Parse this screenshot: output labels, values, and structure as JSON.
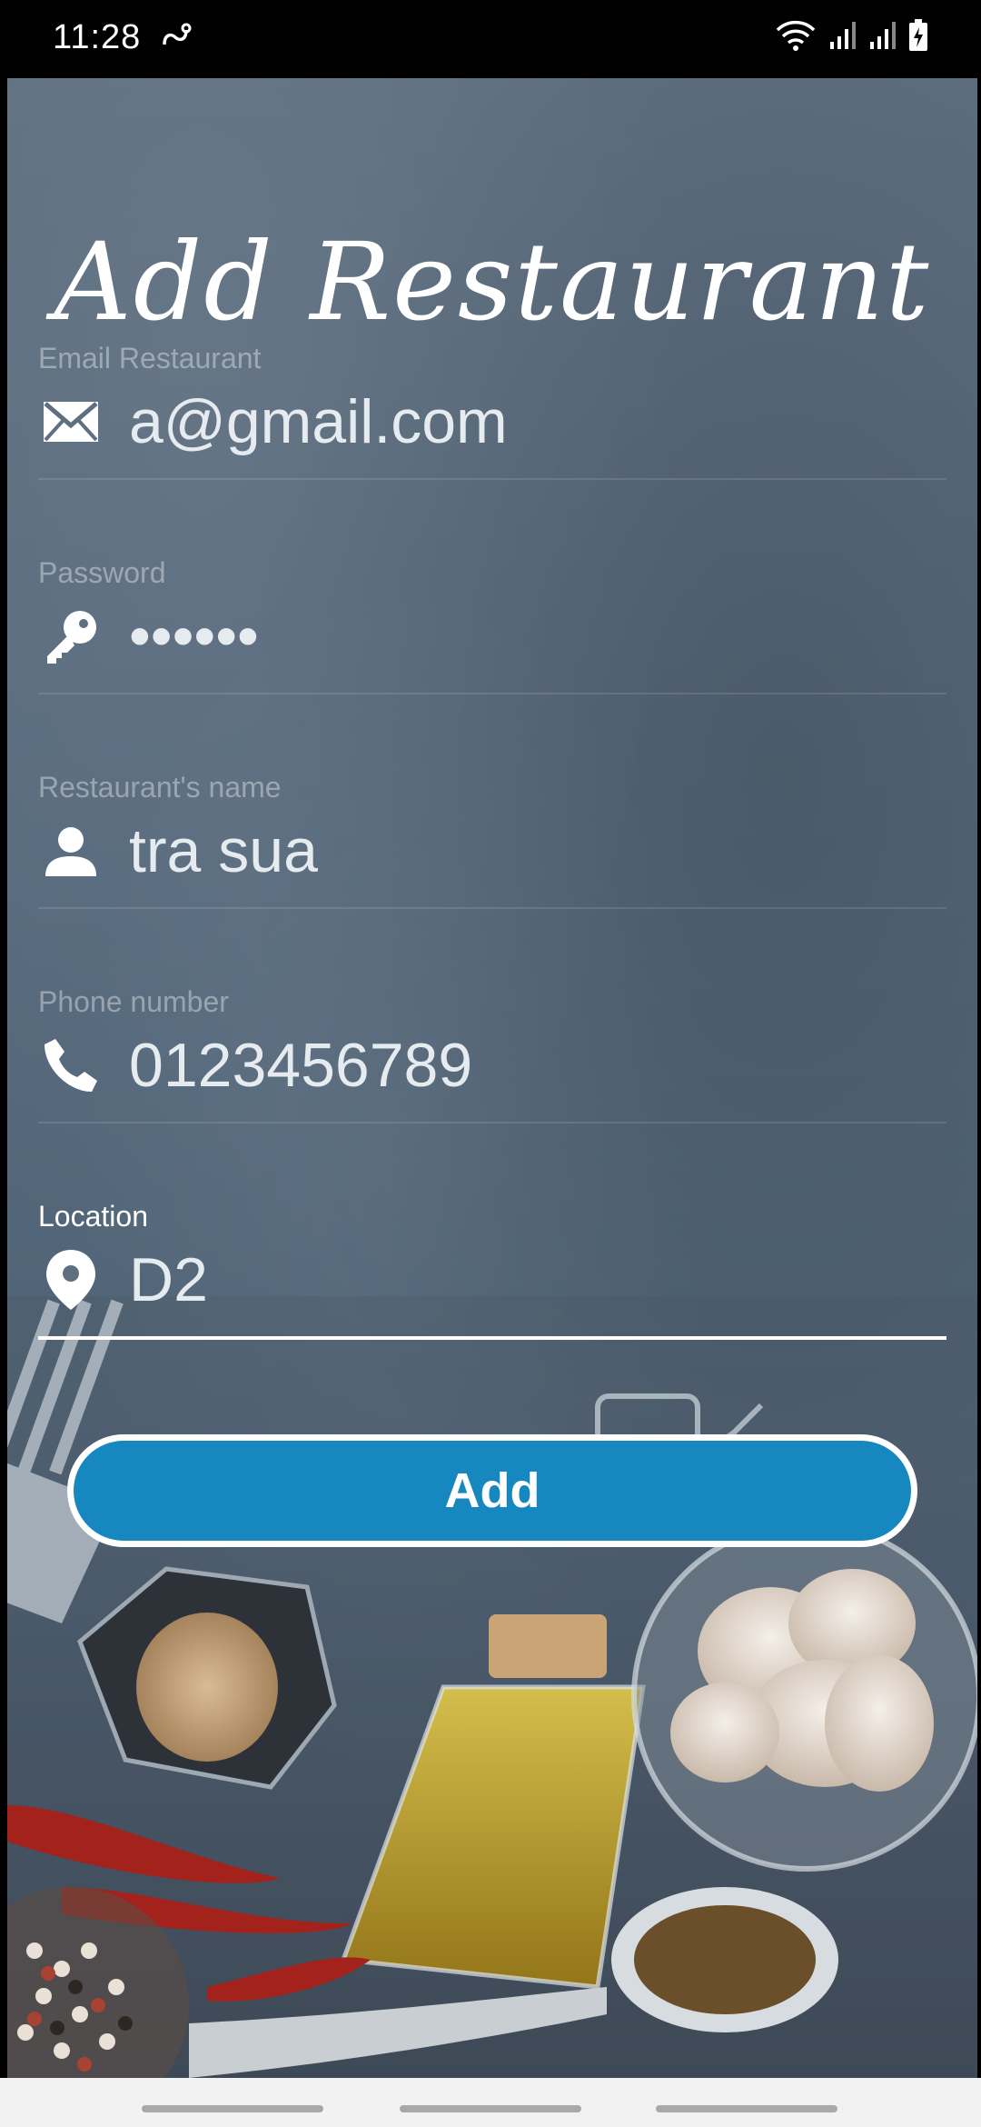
{
  "status_bar": {
    "time": "11:28"
  },
  "title": "Add Restaurant",
  "fields": [
    {
      "label": "Email Restaurant",
      "value": "a@gmail.com",
      "icon": "envelope-icon"
    },
    {
      "label": "Password",
      "value": "••••••",
      "icon": "key-icon"
    },
    {
      "label": "Restaurant's name",
      "value": "tra sua",
      "icon": "person-icon"
    },
    {
      "label": "Phone number",
      "value": "0123456789",
      "icon": "phone-icon"
    },
    {
      "label": "Location",
      "value": "D2",
      "icon": "location-pin-icon"
    }
  ],
  "add_button": {
    "label": "Add"
  },
  "colors": {
    "accent": "#1788bf",
    "background": "#56697c"
  }
}
